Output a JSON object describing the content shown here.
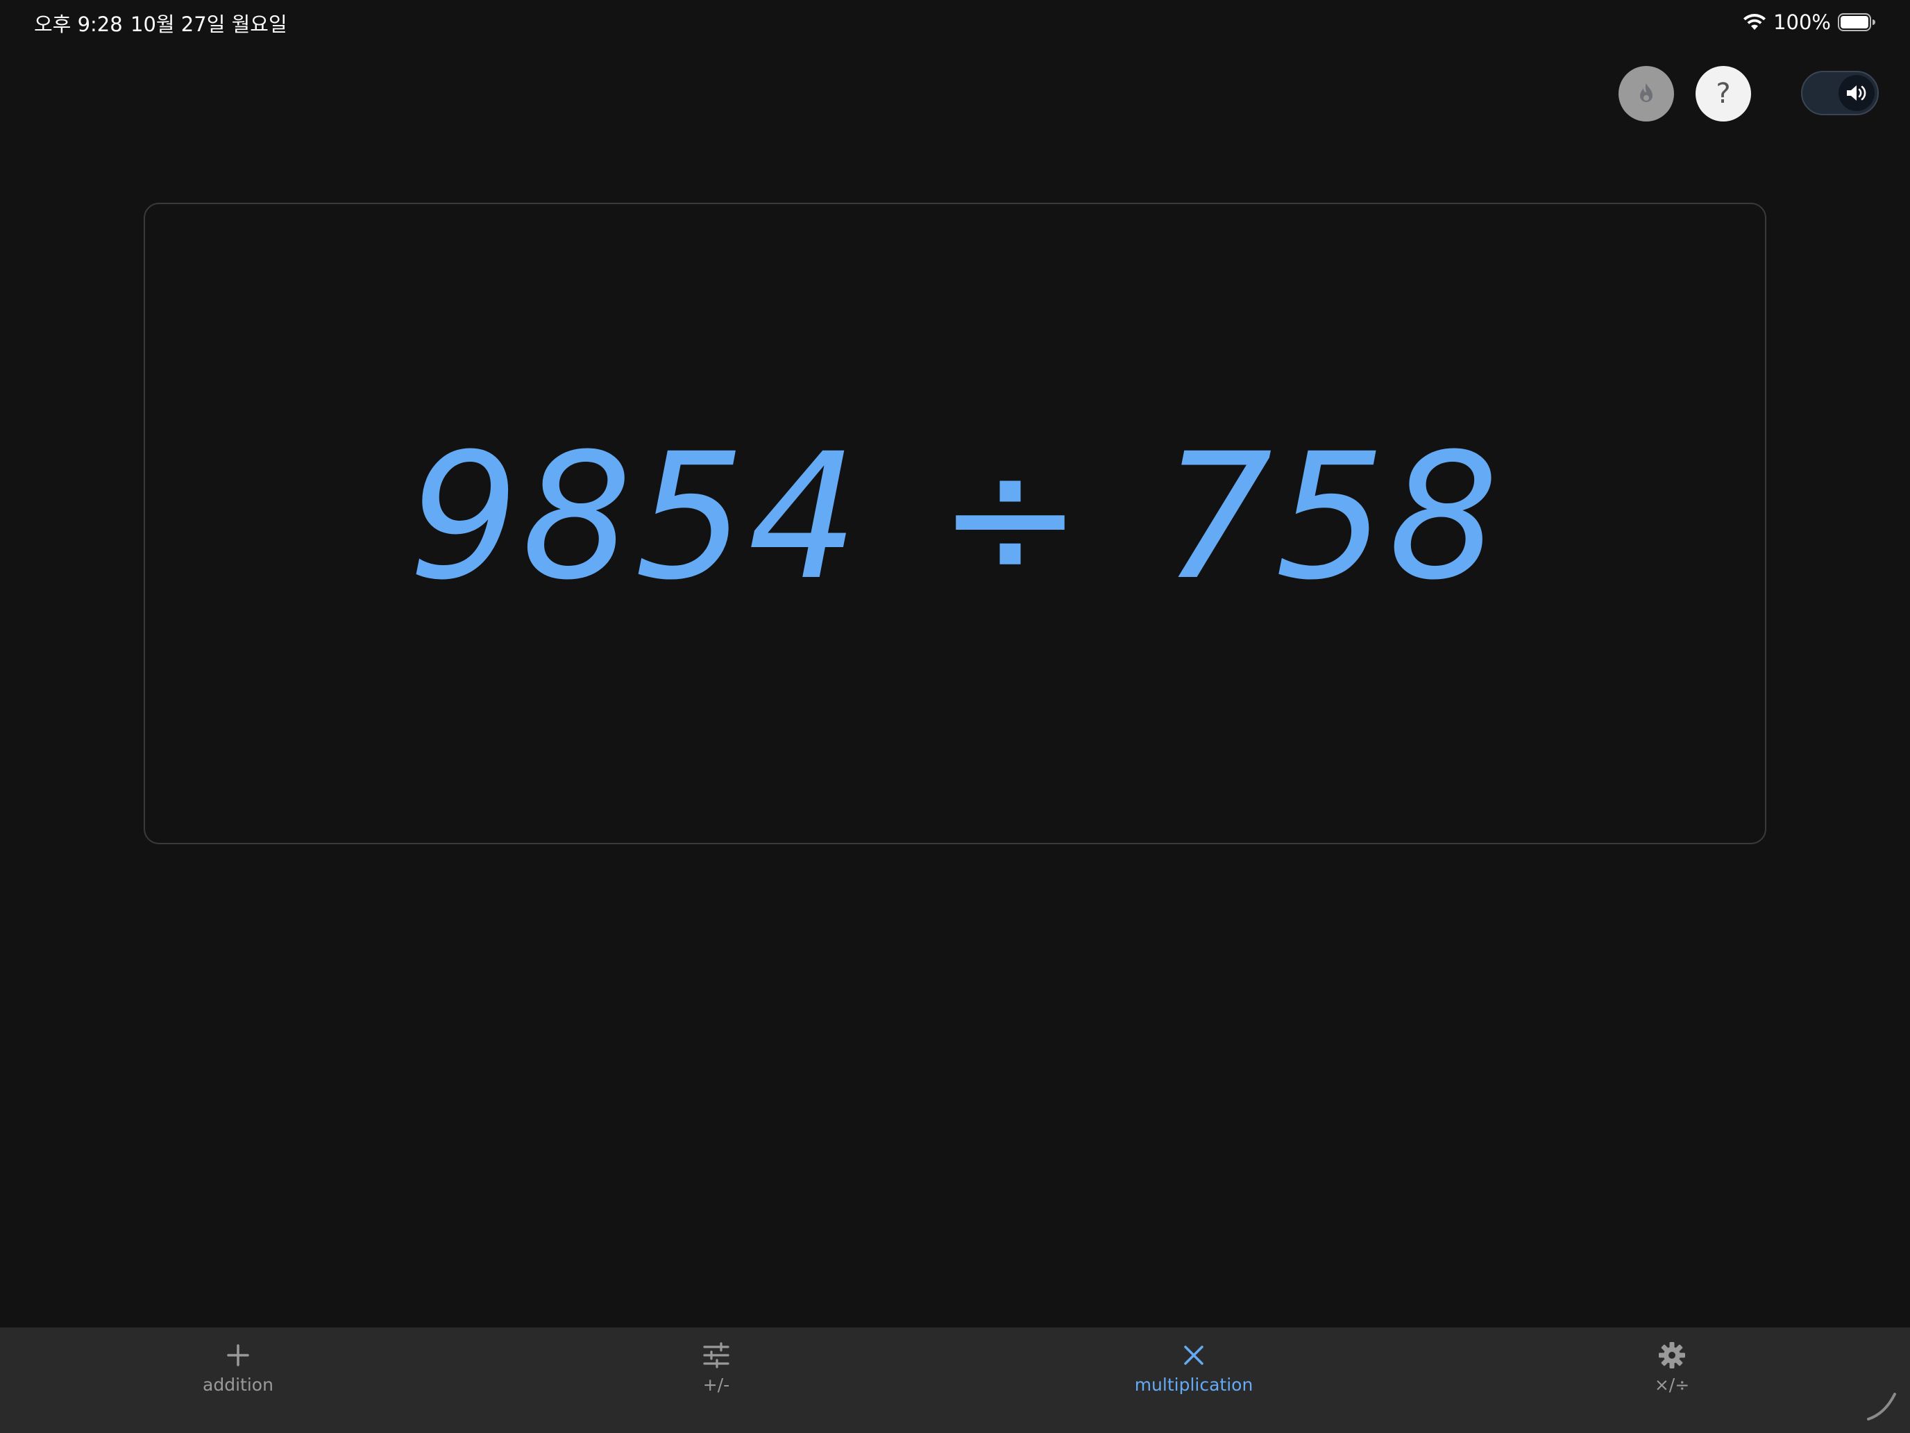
{
  "status_bar": {
    "time": "오후 9:28",
    "date": "10월 27일 월요일",
    "battery_percent": "100%",
    "battery_level": 1.0,
    "wifi_icon": "wifi-icon",
    "battery_icon": "battery-full-icon"
  },
  "header": {
    "streak_icon": "flame-icon",
    "help_label": "?",
    "sound_toggle_on": true,
    "sound_icon": "speaker-icon"
  },
  "problem": {
    "left_operand": "9854",
    "operator": "÷",
    "right_operand": "758"
  },
  "tab_bar": {
    "tabs": [
      {
        "label": "addition",
        "icon": "plus-icon",
        "active": false
      },
      {
        "label": "+/-",
        "icon": "sliders-icon",
        "active": false
      },
      {
        "label": "multiplication",
        "icon": "times-icon",
        "active": true
      },
      {
        "label": "×/÷",
        "icon": "gear-icon",
        "active": false
      }
    ]
  },
  "colors": {
    "background": "#121212",
    "accent": "#64aaf5",
    "tab_bar": "#2a2a2a",
    "inactive_tab": "#9a9a9a"
  }
}
